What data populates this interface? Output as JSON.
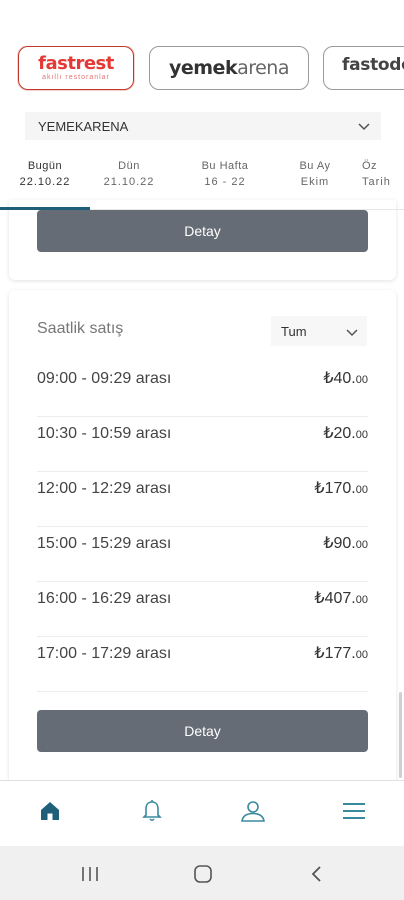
{
  "brands": {
    "fastrest": {
      "name_part1": "fast",
      "name_part2": "rest",
      "tagline": "akıllı restoranlar"
    },
    "yemekarena": {
      "name_part1": "yemek",
      "name_part2": "arena"
    },
    "fastodo": {
      "name": "fastodo"
    }
  },
  "branch_select": {
    "value": "YEMEKARENA"
  },
  "tabs": [
    {
      "label": "Bugün",
      "sub": "22.10.22"
    },
    {
      "label": "Dün",
      "sub": "21.10.22"
    },
    {
      "label": "Bu Hafta",
      "sub": "16 - 22"
    },
    {
      "label": "Bu Ay",
      "sub": "Ekim"
    },
    {
      "label": "Öz",
      "sub": "Tarih"
    }
  ],
  "top_card": {
    "button_label": "Detay"
  },
  "hourly_sales": {
    "title": "Saatlik satış",
    "filter_value": "Tum",
    "rows": [
      {
        "time": "09:00 - 09:29 arası",
        "price": "₺40.",
        "dec": "00"
      },
      {
        "time": "10:30 - 10:59 arası",
        "price": "₺20.",
        "dec": "00"
      },
      {
        "time": "12:00 - 12:29 arası",
        "price": "₺170.",
        "dec": "00"
      },
      {
        "time": "15:00 - 15:29 arası",
        "price": "₺90.",
        "dec": "00"
      },
      {
        "time": "16:00 - 16:29 arası",
        "price": "₺407.",
        "dec": "00"
      },
      {
        "time": "17:00 - 17:29 arası",
        "price": "₺177.",
        "dec": "00"
      }
    ],
    "button_label": "Detay"
  },
  "colors": {
    "accent": "#1f5f7a",
    "button": "#666c75",
    "brand_red": "#e53935"
  },
  "bottom_nav": [
    "home-icon",
    "bell-icon",
    "user-icon",
    "menu-icon"
  ]
}
